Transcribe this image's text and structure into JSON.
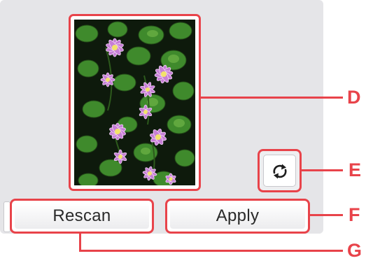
{
  "buttons": {
    "rescan_label": "Rescan",
    "apply_label": "Apply"
  },
  "icons": {
    "rotate": "rotate-icon"
  },
  "callouts": {
    "preview": "D",
    "rotate": "E",
    "apply": "F",
    "rescan": "G"
  },
  "colors": {
    "callout_red": "#e8434a",
    "panel_bg": "#e5e5e8",
    "leaf_green": "#3f8a2c",
    "flower_pink": "#c77fd6"
  }
}
